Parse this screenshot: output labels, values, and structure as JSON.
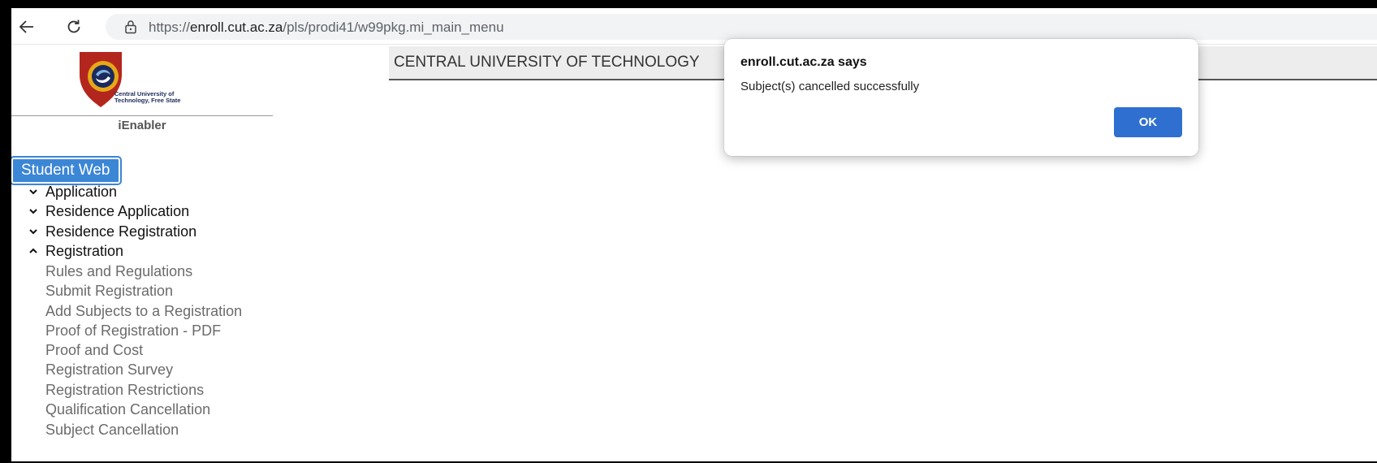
{
  "browser": {
    "url_prefix": "https://",
    "url_host": "enroll.cut.ac.za",
    "url_path": "/pls/prodi41/w99pkg.mi_main_menu"
  },
  "sidebar": {
    "logo_caption": "Central University of\nTechnology, Free State",
    "product": "iEnabler",
    "section_button": "Student Web",
    "menu": [
      {
        "label": "Application",
        "state": "collapsed"
      },
      {
        "label": "Residence Application",
        "state": "collapsed"
      },
      {
        "label": "Residence Registration",
        "state": "collapsed"
      },
      {
        "label": "Registration",
        "state": "expanded"
      }
    ],
    "registration_items": [
      "Rules and Regulations",
      "Submit Registration",
      "Add Subjects to a Registration",
      "Proof of Registration - PDF",
      "Proof and Cost",
      "Registration Survey",
      "Registration Restrictions",
      "Qualification Cancellation",
      "Subject Cancellation"
    ]
  },
  "main": {
    "title": "CENTRAL UNIVERSITY OF TECHNOLOGY"
  },
  "dialog": {
    "title": "enroll.cut.ac.za says",
    "message": "Subject(s) cancelled successfully",
    "ok_label": "OK"
  },
  "colors": {
    "accent": "#3c86d6",
    "ok_button": "#2f6fd0",
    "logo_red": "#b3261e",
    "logo_gold": "#e6a817",
    "logo_navy": "#1b2a5c"
  }
}
